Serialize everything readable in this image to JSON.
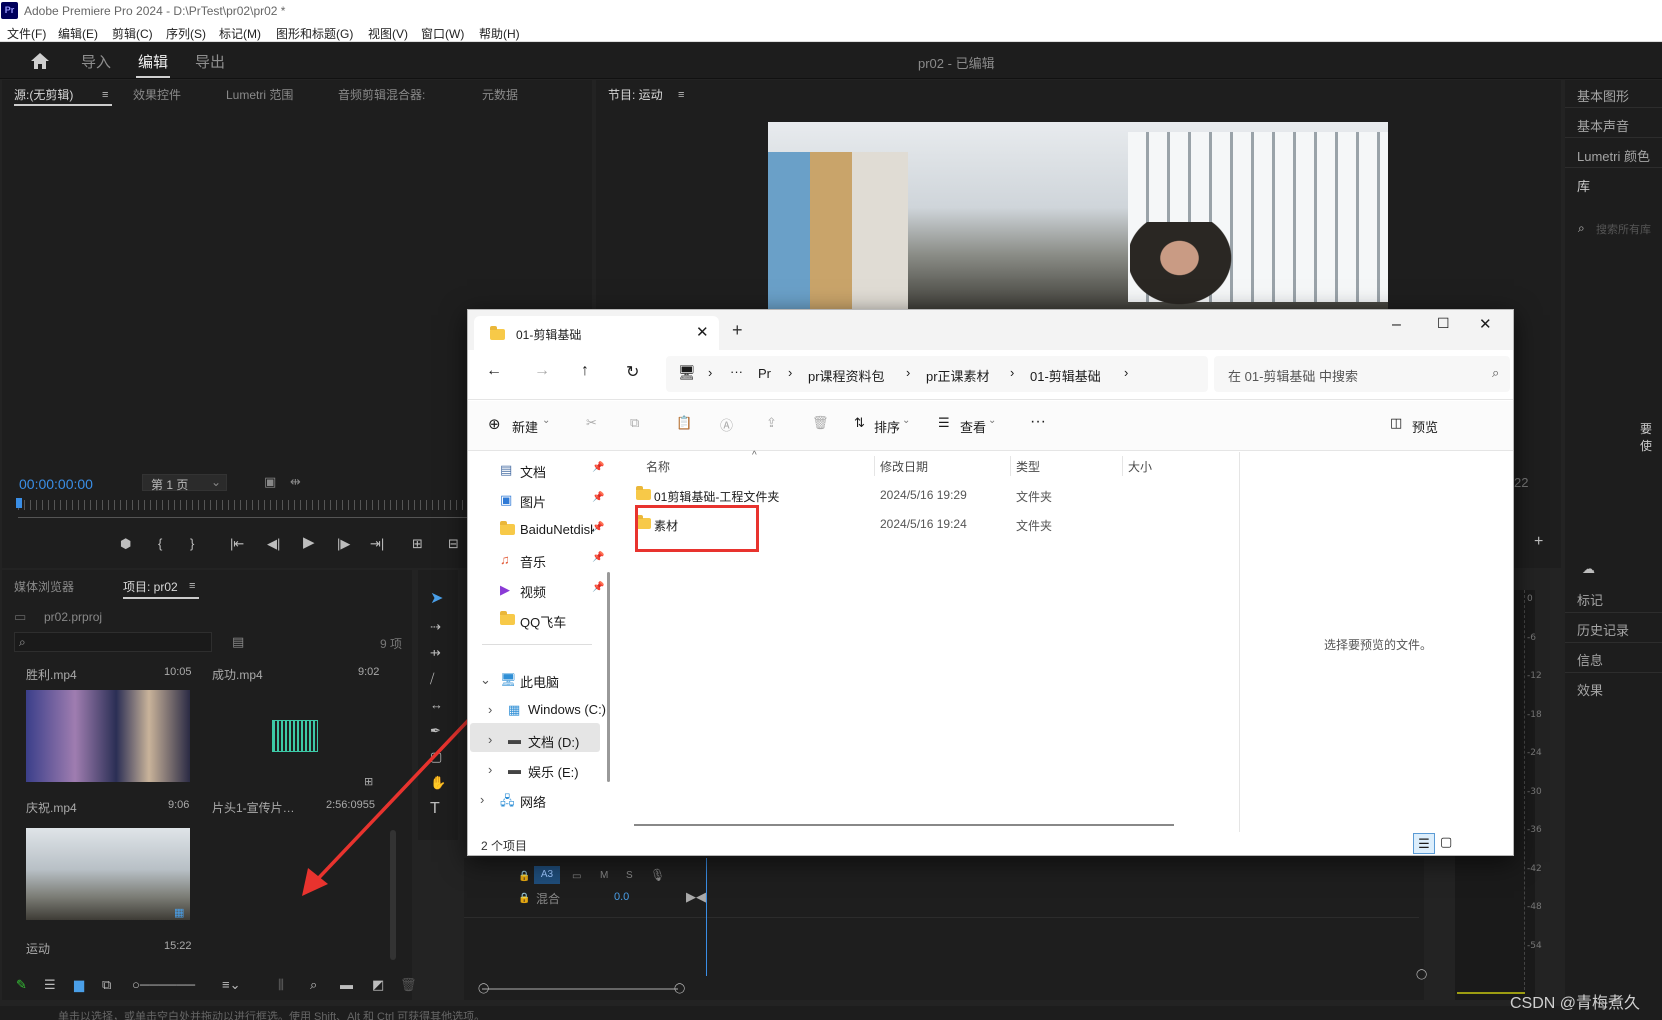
{
  "app": {
    "title": "Adobe Premiere Pro 2024 - D:\\PrTest\\pr02\\pr02 *",
    "project_status": "pr02 - 已编辑"
  },
  "menu": [
    "文件(F)",
    "编辑(E)",
    "剪辑(C)",
    "序列(S)",
    "标记(M)",
    "图形和标题(G)",
    "视图(V)",
    "窗口(W)",
    "帮助(H)"
  ],
  "nav": {
    "import": "导入",
    "edit": "编辑",
    "export": "导出"
  },
  "source_tabs": [
    "源:(无剪辑)",
    "效果控件",
    "Lumetri 范围",
    "音频剪辑混合器:",
    "元数据"
  ],
  "source": {
    "timecode": "00:00:00:00",
    "page": "第 1 页"
  },
  "program": {
    "title": "节目: 运动",
    "timecode_right": "22"
  },
  "right_panel": {
    "items": [
      "基本图形",
      "基本声音",
      "Lumetri 颜色",
      "库"
    ],
    "search_placeholder": "搜索所有库",
    "cut_text": "要使",
    "bottom_items": [
      "标记",
      "历史记录",
      "信息",
      "效果"
    ]
  },
  "project": {
    "tabs": [
      "媒体浏览器",
      "项目: pr02"
    ],
    "file": "pr02.prproj",
    "count": "9 项",
    "items": [
      {
        "name": "胜利.mp4",
        "duration": "10:05"
      },
      {
        "name": "成功.mp4",
        "duration": "9:02"
      },
      {
        "name": "庆祝.mp4",
        "duration": "9:06"
      },
      {
        "name": "片头1-宣传片…",
        "duration": "2:56:0955"
      },
      {
        "name": "运动",
        "duration": "15:22"
      }
    ]
  },
  "timeline": {
    "track": "A3",
    "mix_label": "混合",
    "mix_value": "0.0",
    "m": "M",
    "s": "S"
  },
  "meter_scale": [
    "0",
    "-6",
    "-12",
    "-18",
    "-24",
    "-30",
    "-36",
    "-42",
    "-48",
    "-54"
  ],
  "status_bar": "单击以选择，或单击空白处并拖动以进行框选。使用 Shift、Alt 和 Ctrl 可获得其他选项。",
  "watermark": "CSDN @青梅煮久",
  "explorer": {
    "tab_title": "01-剪辑基础",
    "breadcrumb": [
      "Pr",
      "pr课程资料包",
      "pr正课素材",
      "01-剪辑基础"
    ],
    "search_placeholder": "在 01-剪辑基础 中搜索",
    "toolbar": {
      "new": "新建",
      "sort": "排序",
      "view": "查看",
      "preview": "预览"
    },
    "quick_access": [
      "文档",
      "图片",
      "BaiduNetdisk",
      "音乐",
      "视频",
      "QQ飞车"
    ],
    "this_pc": "此电脑",
    "drives": [
      "Windows (C:)",
      "文档 (D:)",
      "娱乐 (E:)"
    ],
    "network": "网络",
    "columns": [
      "名称",
      "修改日期",
      "类型",
      "大小"
    ],
    "files": [
      {
        "name": "01剪辑基础-工程文件夹",
        "date": "2024/5/16 19:29",
        "type": "文件夹"
      },
      {
        "name": "素材",
        "date": "2024/5/16 19:24",
        "type": "文件夹"
      }
    ],
    "preview_text": "选择要预览的文件。",
    "item_count": "2 个项目"
  }
}
